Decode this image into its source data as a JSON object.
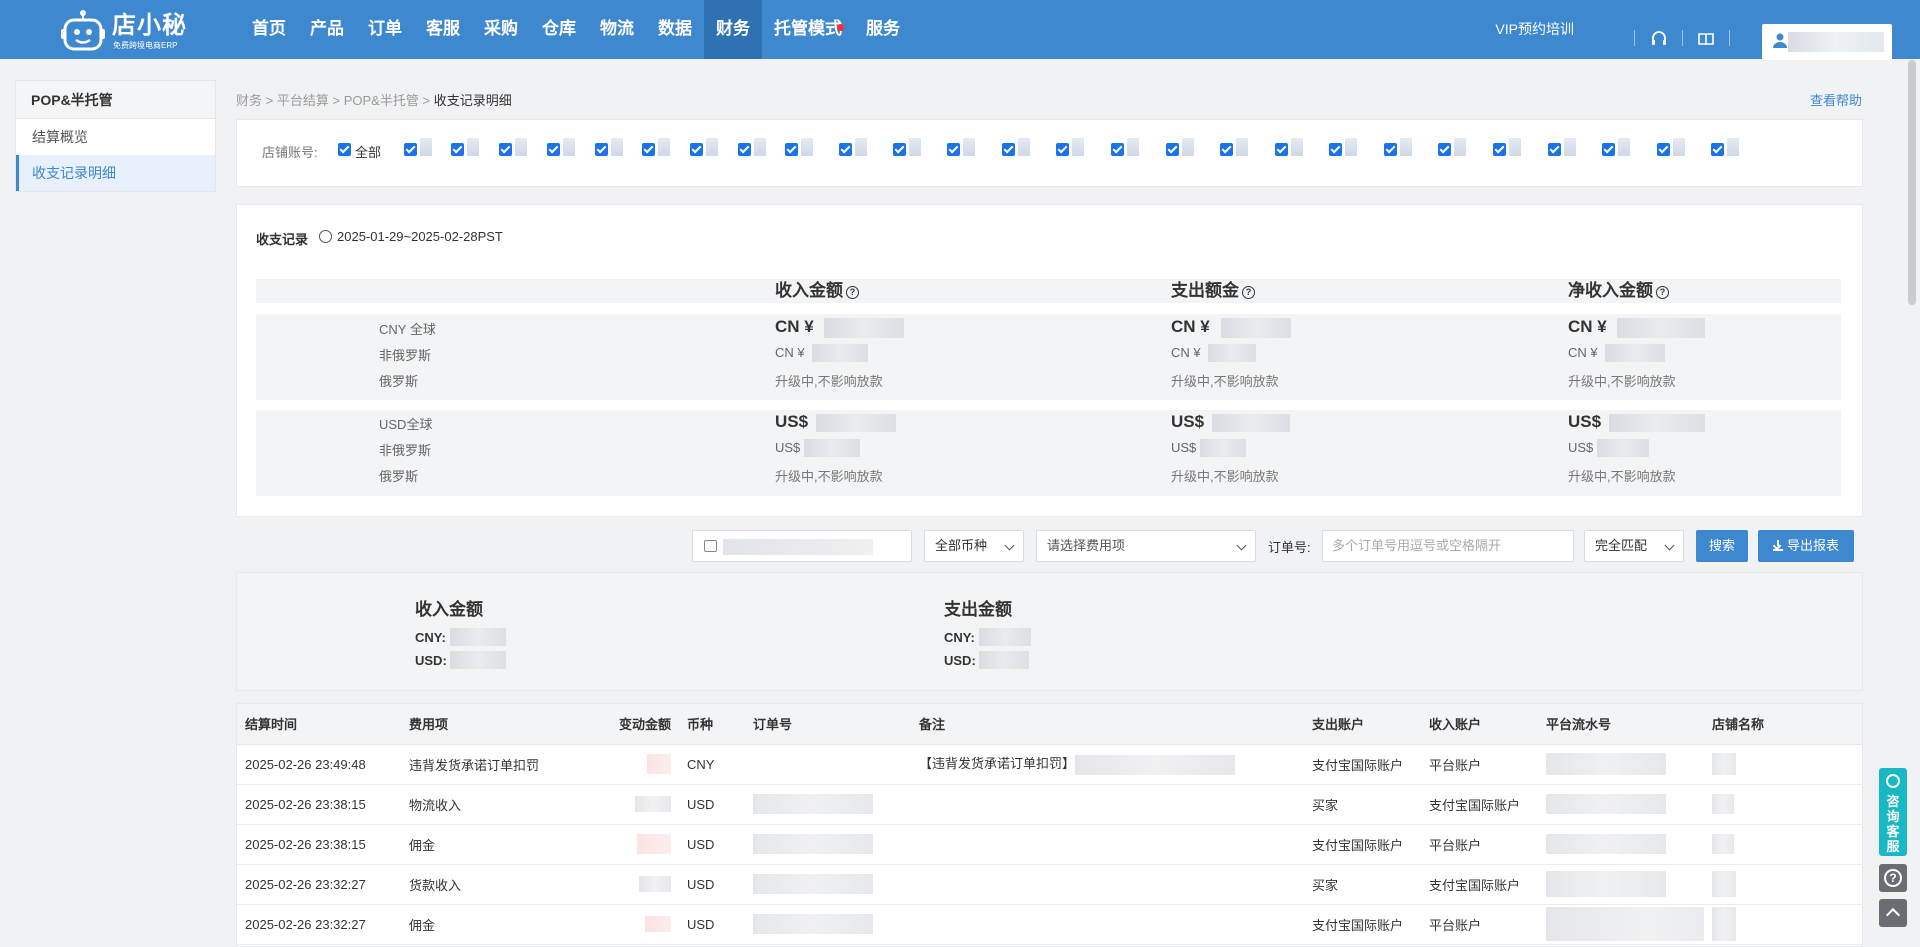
{
  "brand": {
    "name": "店小秘",
    "tagline": "免费跨境电商ERP"
  },
  "nav": [
    {
      "label": "首页"
    },
    {
      "label": "产品"
    },
    {
      "label": "订单"
    },
    {
      "label": "客服"
    },
    {
      "label": "采购"
    },
    {
      "label": "仓库"
    },
    {
      "label": "物流"
    },
    {
      "label": "数据"
    },
    {
      "label": "财务",
      "active": true
    },
    {
      "label": "托管模式",
      "badge": true
    },
    {
      "label": "服务"
    }
  ],
  "header": {
    "vip_link": "VIP预约培训"
  },
  "sidebar": {
    "title": "POP&半托管",
    "items": [
      {
        "label": "结算概览"
      },
      {
        "label": "收支记录明细",
        "active": true
      }
    ]
  },
  "breadcrumb": {
    "l1": "财务",
    "l2": "平台结算",
    "l3": "POP&半托管",
    "current": "收支记录明细",
    "sep": ">"
  },
  "help_link": "查看帮助",
  "shops": {
    "label": "店铺账号:",
    "all_label": "全部"
  },
  "summary": {
    "title": "收支记录",
    "period": "2025-01-29~2025-02-28PST",
    "columns": {
      "income": "收入金额",
      "expense": "支出额金",
      "net": "净收入金额"
    },
    "cny": {
      "labels": [
        "CNY 全球",
        "非俄罗斯",
        "俄罗斯"
      ],
      "big_prefix": "CN ¥",
      "small_prefix": "CN ¥",
      "note": "升级中,不影响放款"
    },
    "usd": {
      "labels": [
        "USD全球",
        "非俄罗斯",
        "俄罗斯"
      ],
      "big_prefix": "US$",
      "small_prefix": "US$",
      "note": "升级中,不影响放款"
    }
  },
  "filters": {
    "currency": "全部币种",
    "fee_type": "请选择费用项",
    "order_label": "订单号:",
    "order_placeholder": "多个订单号用逗号或空格隔开",
    "match_mode": "完全匹配",
    "search": "搜索",
    "export": "导出报表"
  },
  "totals": {
    "income_title": "收入金额",
    "expense_title": "支出金额",
    "cny_label": "CNY:",
    "usd_label": "USD:"
  },
  "table": {
    "headers": [
      "结算时间",
      "费用项",
      "变动金额",
      "币种",
      "订单号",
      "备注",
      "支出账户",
      "收入账户",
      "平台流水号",
      "店铺名称"
    ],
    "rows": [
      {
        "time": "2025-02-26 23:49:48",
        "fee": "违背发货承诺订单扣罚",
        "currency": "CNY",
        "remark": "【违背发货承诺订单扣罚】",
        "out": "支付宝国际账户",
        "in": "平台账户"
      },
      {
        "time": "2025-02-26 23:38:15",
        "fee": "物流收入",
        "currency": "USD",
        "remark": "",
        "out": "买家",
        "in": "支付宝国际账户"
      },
      {
        "time": "2025-02-26 23:38:15",
        "fee": "佣金",
        "currency": "USD",
        "remark": "",
        "out": "支付宝国际账户",
        "in": "平台账户"
      },
      {
        "time": "2025-02-26 23:32:27",
        "fee": "货款收入",
        "currency": "USD",
        "remark": "",
        "out": "买家",
        "in": "支付宝国际账户"
      },
      {
        "time": "2025-02-26 23:32:27",
        "fee": "佣金",
        "currency": "USD",
        "remark": "",
        "out": "支付宝国际账户",
        "in": "平台账户"
      }
    ]
  },
  "float_widget": {
    "consult": "咨询客服",
    "help_symbol": "?"
  }
}
